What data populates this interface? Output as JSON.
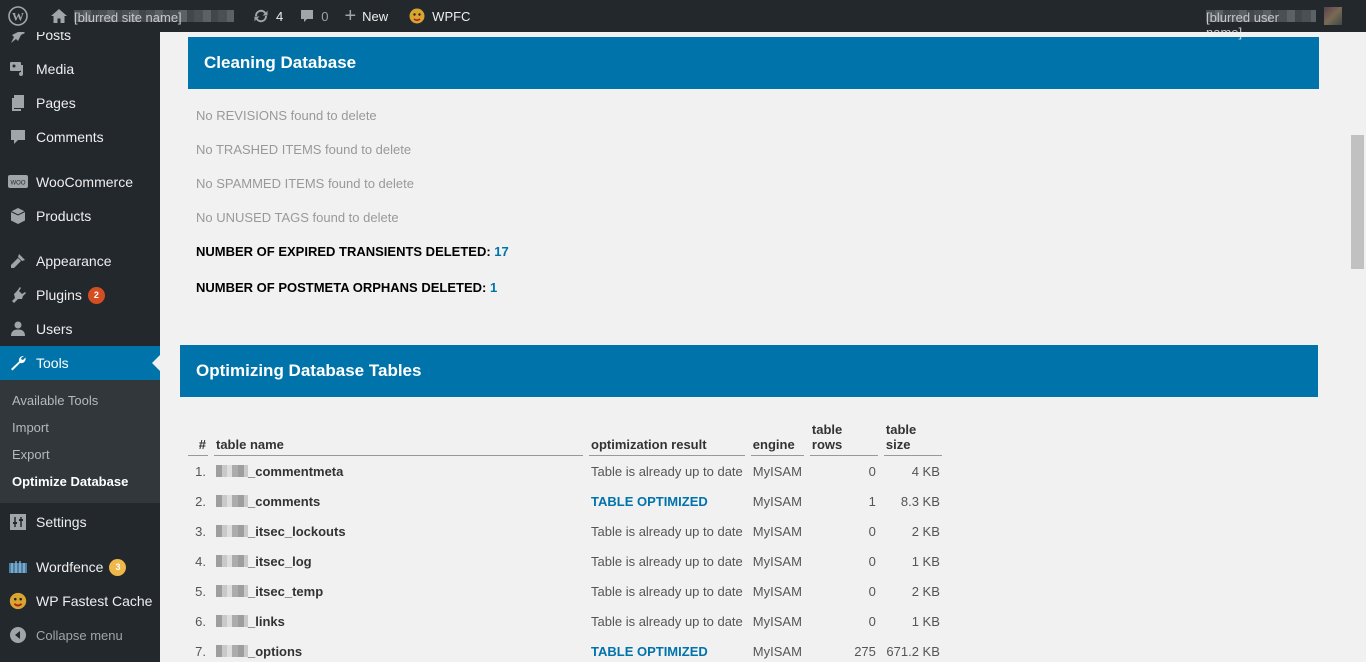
{
  "adminbar": {
    "wp_logo": "wordpress-logo-icon",
    "site_name": "[blurred site name]",
    "updates_count": "4",
    "comments_count": "0",
    "new_label": "New",
    "wpfc_label": "WPFC",
    "account_name": "[blurred user name]"
  },
  "sidebar": {
    "items": [
      {
        "label": "Posts",
        "icon": "pin-icon"
      },
      {
        "label": "Media",
        "icon": "media-icon"
      },
      {
        "label": "Pages",
        "icon": "pages-icon"
      },
      {
        "label": "Comments",
        "icon": "comment-icon"
      },
      {
        "label": "WooCommerce",
        "icon": "woo-icon"
      },
      {
        "label": "Products",
        "icon": "box-icon"
      },
      {
        "label": "Appearance",
        "icon": "brush-icon"
      },
      {
        "label": "Plugins",
        "icon": "plugin-icon",
        "badge": "2"
      },
      {
        "label": "Users",
        "icon": "user-icon"
      },
      {
        "label": "Tools",
        "icon": "wrench-icon"
      },
      {
        "label": "Settings",
        "icon": "sliders-icon"
      },
      {
        "label": "Wordfence",
        "icon": "wordfence-icon",
        "badge": "3"
      },
      {
        "label": "WP Fastest Cache",
        "icon": "cheetah-icon"
      },
      {
        "label": "Collapse menu",
        "icon": "collapse-icon"
      }
    ],
    "tools_submenu": [
      "Available Tools",
      "Import",
      "Export",
      "Optimize Database"
    ],
    "active_item": "Tools",
    "current_subitem": "Optimize Database"
  },
  "cleaning": {
    "title": "Cleaning Database",
    "lines": [
      "No REVISIONS found to delete",
      "No TRASHED ITEMS found to delete",
      "No SPAMMED ITEMS found to delete",
      "No UNUSED TAGS found to delete"
    ],
    "transients_label": "NUMBER OF EXPIRED TRANSIENTS DELETED: ",
    "transients_value": "17",
    "orphans_label": "NUMBER OF POSTMETA ORPHANS DELETED: ",
    "orphans_value": "1"
  },
  "optimizing": {
    "title": "Optimizing Database Tables",
    "columns": [
      "#",
      "table name",
      "optimization result",
      "engine",
      "table rows",
      "table size"
    ],
    "rows": [
      {
        "idx": "1.",
        "name": "_commentmeta",
        "result": "Table is already up to date",
        "optimized": false,
        "engine": "MyISAM",
        "rows": "0",
        "size": "4 KB"
      },
      {
        "idx": "2.",
        "name": "_comments",
        "result": "TABLE OPTIMIZED",
        "optimized": true,
        "engine": "MyISAM",
        "rows": "1",
        "size": "8.3 KB"
      },
      {
        "idx": "3.",
        "name": "_itsec_lockouts",
        "result": "Table is already up to date",
        "optimized": false,
        "engine": "MyISAM",
        "rows": "0",
        "size": "2 KB"
      },
      {
        "idx": "4.",
        "name": "_itsec_log",
        "result": "Table is already up to date",
        "optimized": false,
        "engine": "MyISAM",
        "rows": "0",
        "size": "1 KB"
      },
      {
        "idx": "5.",
        "name": "_itsec_temp",
        "result": "Table is already up to date",
        "optimized": false,
        "engine": "MyISAM",
        "rows": "0",
        "size": "2 KB"
      },
      {
        "idx": "6.",
        "name": "_links",
        "result": "Table is already up to date",
        "optimized": false,
        "engine": "MyISAM",
        "rows": "0",
        "size": "1 KB"
      },
      {
        "idx": "7.",
        "name": "_options",
        "result": "TABLE OPTIMIZED",
        "optimized": true,
        "engine": "MyISAM",
        "rows": "275",
        "size": "671.2 KB"
      }
    ]
  },
  "colors": {
    "accent": "#0073aa",
    "adminbar_bg": "#23282d",
    "badge_plugins": "#d54e21",
    "badge_wordfence": "#f0b849",
    "page_bg": "#f1f1f1"
  }
}
